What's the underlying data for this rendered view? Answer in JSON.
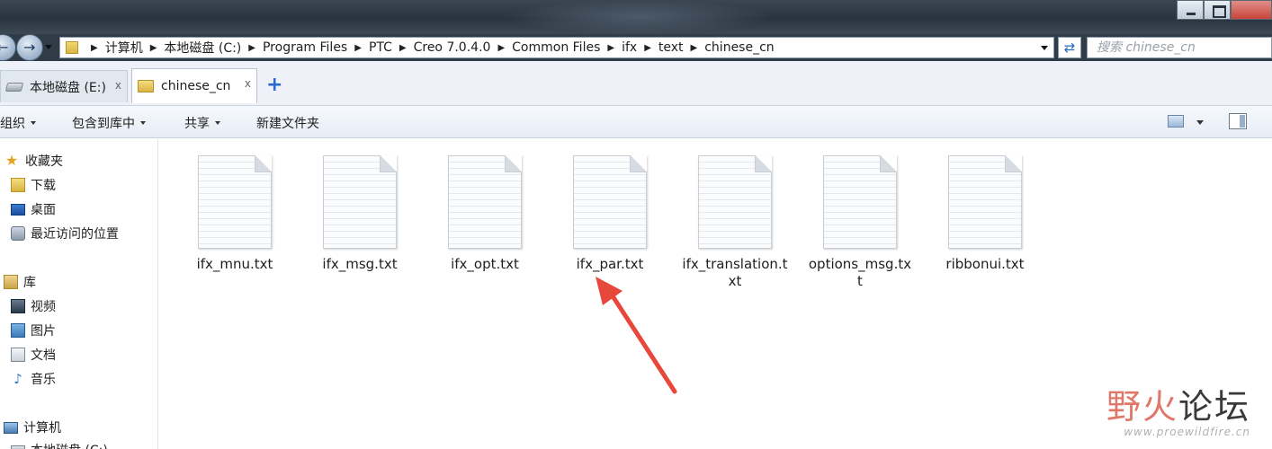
{
  "window": {
    "controls": [
      "minimize-icon",
      "maximize-icon",
      "close-icon"
    ]
  },
  "address_bar": {
    "segments": [
      "计算机",
      "本地磁盘 (C:)",
      "Program Files",
      "PTC",
      "Creo 7.0.4.0",
      "Common Files",
      "ifx",
      "text",
      "chinese_cn"
    ]
  },
  "search": {
    "placeholder": "搜索 chinese_cn"
  },
  "tabs": [
    {
      "label": "本地磁盘 (E:)",
      "icon": "drive-icon",
      "active": false
    },
    {
      "label": "chinese_cn",
      "icon": "folder-icon",
      "active": true
    }
  ],
  "tab_close_glyph": "x",
  "new_tab_glyph": "+",
  "toolbar": {
    "organize": "组织",
    "include_library": "包含到库中",
    "share": "共享",
    "new_folder": "新建文件夹"
  },
  "sidebar": {
    "favorites": {
      "title": "收藏夹",
      "items": [
        "下载",
        "桌面",
        "最近访问的位置"
      ]
    },
    "libraries": {
      "title": "库",
      "items": [
        "视频",
        "图片",
        "文档",
        "音乐"
      ]
    },
    "computer": {
      "title": "计算机",
      "items": [
        "本地磁盘 (C:)"
      ]
    }
  },
  "files": [
    "ifx_mnu.txt",
    "ifx_msg.txt",
    "ifx_opt.txt",
    "ifx_par.txt",
    "ifx_translation.txt",
    "options_msg.txt",
    "ribbonui.txt"
  ],
  "annotation": {
    "arrow_color": "#e8483c",
    "points_to": "ifx_par.txt"
  },
  "watermark": {
    "title_part1": "野火",
    "title_part2": "论坛",
    "url": "www.proewildfire.cn"
  },
  "colors": {
    "titlebar": "#2a3440",
    "accent": "#2a68d0",
    "arrow": "#e8483c"
  }
}
